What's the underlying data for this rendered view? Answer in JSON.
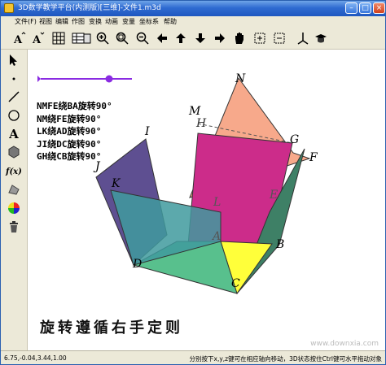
{
  "window": {
    "title": "3D数学教学平台(内测版)[三维]-文件1.m3d"
  },
  "menu": [
    "文件(F)",
    "视图",
    "编辑",
    "作图",
    "变换",
    "动画",
    "变量",
    "坐标系",
    "帮助"
  ],
  "toolbar_icons": [
    "font-increase-icon",
    "font-decrease-icon",
    "grid-icon",
    "table-icon",
    "bookmark-icon",
    "zoom-in-icon",
    "zoom-actual-icon",
    "zoom-out-icon",
    "arrow-left-icon",
    "arrow-up-icon",
    "arrow-down-icon",
    "arrow-right-icon",
    "hand-icon",
    "frame-plus-icon",
    "frame-minus-icon",
    "axes-icon",
    "graduation-cap-icon"
  ],
  "left_tools": [
    "pointer-tool-icon",
    "point-tool-icon",
    "line-tool-icon",
    "circle-tool-icon",
    "text-tool-icon",
    "polygon-tool-icon",
    "function-tool-icon",
    "shape-tool-icon",
    "color-tool-icon",
    "delete-tool-icon"
  ],
  "left_text_tools": {
    "text": "A",
    "function": "f(x)"
  },
  "slider": {
    "value": 0.75
  },
  "animation_labels": [
    "NMFE绕BA旋转90°",
    "NM绕FE旋转90°",
    "LK绕AD旋转90°",
    "JI绕DC旋转90°",
    "GH绕CB旋转90°"
  ],
  "points": {
    "N": "N",
    "M": "M",
    "H": "H",
    "G": "G",
    "F": "F",
    "E": "E",
    "I": "I",
    "J": "J",
    "K": "K",
    "L": "L",
    "A": "A",
    "B": "B",
    "D": "D",
    "C": "C"
  },
  "caption": "旋转遵循右手定则",
  "watermark": "www.downxia.com",
  "status": {
    "coords": "6.75,-0.04,3.44,1.00",
    "hint": "分别按下x,y,z键可在相应轴向移动，3D状态按住Ctrl键可水平拖动对象"
  },
  "colors": {
    "orange": "#f7a98b",
    "magenta": "#cc2c8a",
    "purple": "#5e4f91",
    "teal": "#3f9a9e",
    "green": "#3e8066",
    "yellow": "#ffff3a",
    "slider": "#8a2be2"
  }
}
